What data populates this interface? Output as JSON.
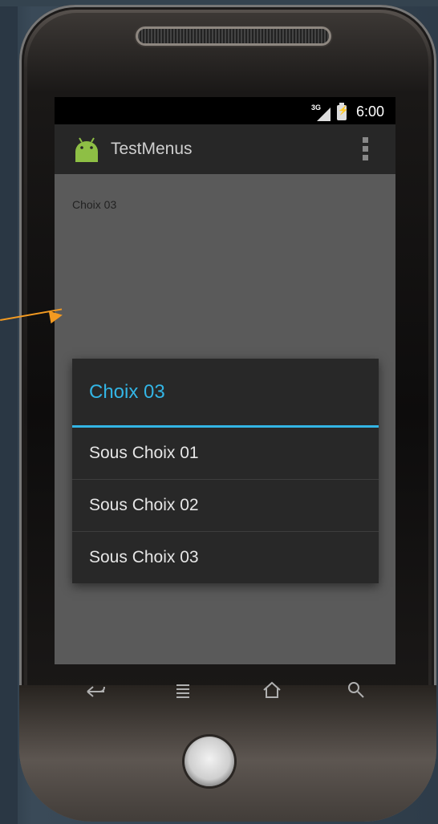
{
  "status_bar": {
    "network": "3G",
    "time": "6:00"
  },
  "action_bar": {
    "app_title": "TestMenus"
  },
  "content": {
    "selected_text": "Choix 03"
  },
  "dialog": {
    "title": "Choix 03",
    "items": [
      {
        "label": "Sous Choix 01"
      },
      {
        "label": "Sous Choix 02"
      },
      {
        "label": "Sous Choix 03"
      }
    ]
  },
  "nav_bar": {
    "icons": [
      "back-icon",
      "menu-icon",
      "home-icon",
      "search-icon"
    ]
  },
  "colors": {
    "accent": "#33b5e5",
    "annotation_arrow": "#f39a21",
    "dialog_bg": "#282828",
    "screen_bg": "#5a5a5a"
  }
}
